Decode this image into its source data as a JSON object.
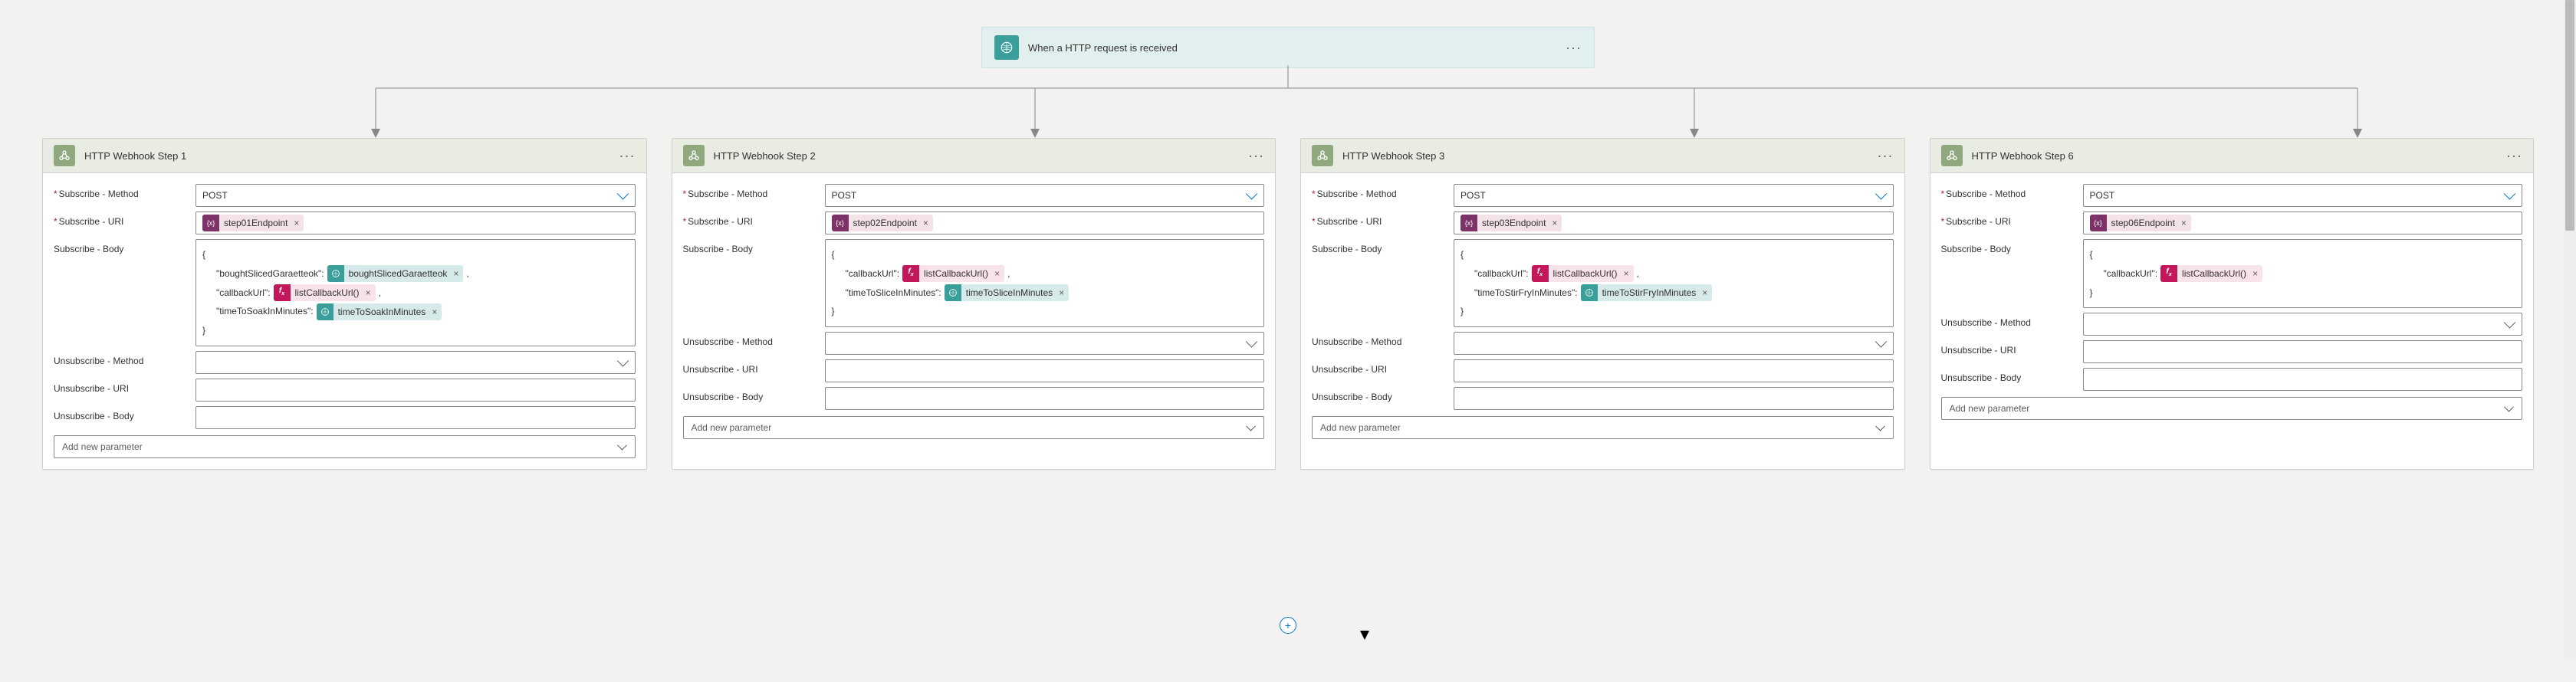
{
  "trigger": {
    "title": "When a HTTP request is received"
  },
  "labels": {
    "subscribeMethod": "Subscribe - Method",
    "subscribeUri": "Subscribe - URI",
    "subscribeBody": "Subscribe - Body",
    "unsubscribeMethod": "Unsubscribe - Method",
    "unsubscribeUri": "Unsubscribe - URI",
    "unsubscribeBody": "Unsubscribe - Body",
    "addParam": "Add new parameter"
  },
  "steps": [
    {
      "title": "HTTP Webhook Step 1",
      "method": "POST",
      "uriToken": {
        "type": "purple",
        "label": "step01Endpoint"
      },
      "body": [
        {
          "text": "{"
        },
        {
          "text": "\"boughtSlicedGaraetteok\":",
          "token": {
            "type": "teal",
            "label": "boughtSlicedGaraetteok"
          },
          "comma": true
        },
        {
          "text": "\"callbackUrl\":",
          "token": {
            "type": "pink",
            "label": "listCallbackUrl()"
          },
          "comma": true
        },
        {
          "text": "\"timeToSoakInMinutes\":",
          "token": {
            "type": "teal",
            "label": "timeToSoakInMinutes"
          }
        },
        {
          "text": "}"
        }
      ]
    },
    {
      "title": "HTTP Webhook Step 2",
      "method": "POST",
      "uriToken": {
        "type": "purple",
        "label": "step02Endpoint"
      },
      "body": [
        {
          "text": "{"
        },
        {
          "text": "\"callbackUrl\":",
          "token": {
            "type": "pink",
            "label": "listCallbackUrl()"
          },
          "comma": true
        },
        {
          "text": "\"timeToSliceInMinutes\":",
          "token": {
            "type": "teal",
            "label": "timeToSliceInMinutes"
          }
        },
        {
          "text": "}"
        }
      ]
    },
    {
      "title": "HTTP Webhook Step 3",
      "method": "POST",
      "uriToken": {
        "type": "purple",
        "label": "step03Endpoint"
      },
      "body": [
        {
          "text": "{"
        },
        {
          "text": "\"callbackUrl\":",
          "token": {
            "type": "pink",
            "label": "listCallbackUrl()"
          },
          "comma": true
        },
        {
          "text": "\"timeToStirFryInMinutes\":",
          "token": {
            "type": "teal",
            "label": "timeToStirFryInMinutes"
          }
        },
        {
          "text": "}"
        }
      ]
    },
    {
      "title": "HTTP Webhook Step 6",
      "method": "POST",
      "uriToken": {
        "type": "purple",
        "label": "step06Endpoint"
      },
      "body": [
        {
          "text": "{"
        },
        {
          "text": "\"callbackUrl\":",
          "token": {
            "type": "pink",
            "label": "listCallbackUrl()"
          }
        },
        {
          "text": "}"
        }
      ]
    }
  ]
}
